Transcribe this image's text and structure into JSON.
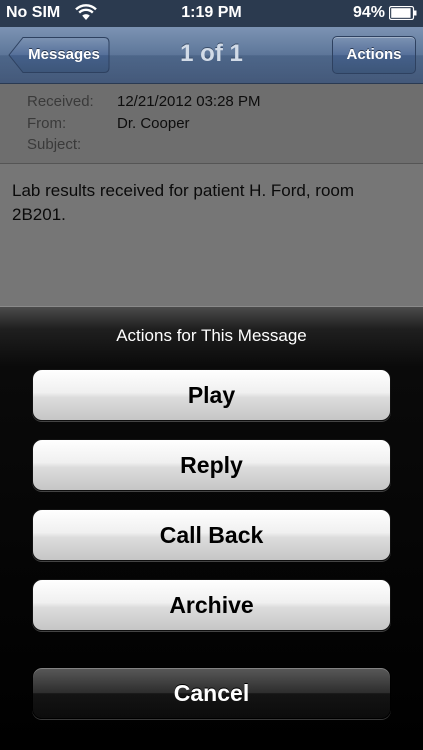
{
  "status_bar": {
    "carrier": "No SIM",
    "time": "1:19 PM",
    "battery_percent": "94%",
    "battery_level": 0.94
  },
  "nav": {
    "back_label": "Messages",
    "title": "1 of 1",
    "actions_label": "Actions"
  },
  "message": {
    "received_label": "Received:",
    "received_value": "12/21/2012 03:28 PM",
    "from_label": "From:",
    "from_value": "Dr. Cooper",
    "subject_label": "Subject:",
    "subject_value": "",
    "body": "Lab results received for patient H. Ford, room 2B201."
  },
  "action_sheet": {
    "title": "Actions for This Message",
    "buttons": [
      "Play",
      "Reply",
      "Call Back",
      "Archive"
    ],
    "cancel_label": "Cancel"
  },
  "colors": {
    "nav_bar": "#5d7699",
    "status_bar": "#2b3a4f",
    "sheet_background": "#000000"
  },
  "icons": [
    "wifi-icon",
    "battery-icon",
    "back-arrow-icon"
  ]
}
